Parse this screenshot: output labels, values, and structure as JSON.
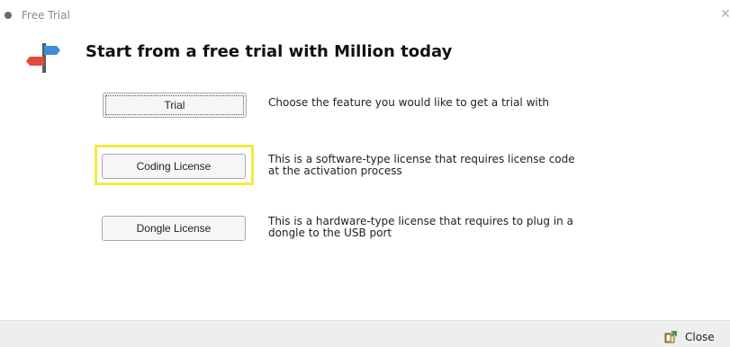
{
  "window": {
    "title": "Free Trial",
    "close_glyph": "✕"
  },
  "header": {
    "title": "Start from a free trial with Million today",
    "icon": "signpost-icon"
  },
  "options": [
    {
      "button_label": "Trial",
      "description": "Choose the feature you would like to get a trial with"
    },
    {
      "button_label": "Coding License",
      "description_line1": "This is a software-type license that requires license code",
      "description_line2": "at the activation process",
      "highlight_color": "#f1ec3a"
    },
    {
      "button_label": "Dongle License",
      "description_line1": "This is a hardware-type license that requires to plug in a",
      "description_line2": "dongle to the USB port"
    }
  ],
  "footer": {
    "close_label": "Close",
    "close_icon": "exit-door-icon"
  }
}
